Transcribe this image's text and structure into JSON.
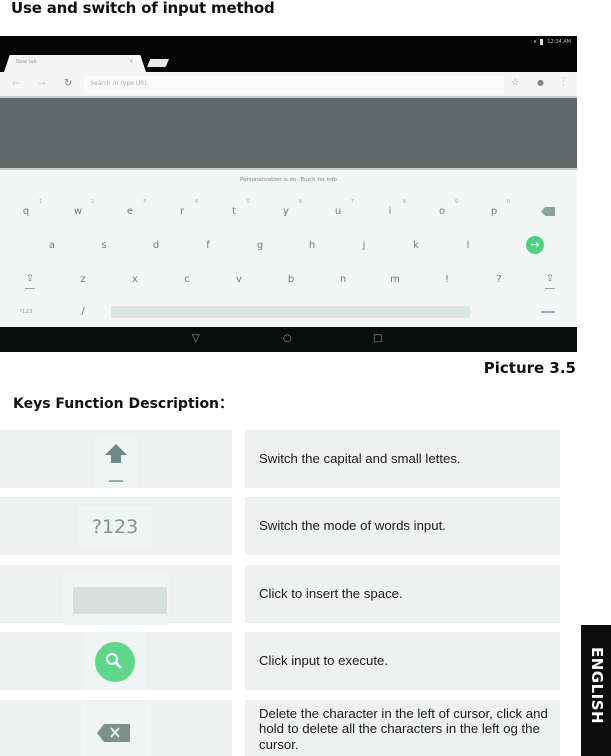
{
  "heading": "Use and switch of input method",
  "screenshot": {
    "status_bar": {
      "time": "12:34 AM"
    },
    "browser": {
      "tab_title": "New tab",
      "tab_close": "×",
      "omnibox_placeholder": "Search or type URL",
      "icons": [
        "back-icon",
        "forward-icon",
        "reload-icon",
        "star-icon",
        "mic-icon",
        "menu-icon"
      ]
    },
    "keyboard": {
      "suggestion_text": "Personalization is on. Touch for info",
      "row1": [
        {
          "key": "q",
          "hint": "1"
        },
        {
          "key": "w",
          "hint": "2"
        },
        {
          "key": "e",
          "hint": "3"
        },
        {
          "key": "r",
          "hint": "4"
        },
        {
          "key": "t",
          "hint": "5"
        },
        {
          "key": "y",
          "hint": "6"
        },
        {
          "key": "u",
          "hint": "7"
        },
        {
          "key": "i",
          "hint": "8"
        },
        {
          "key": "o",
          "hint": "9"
        },
        {
          "key": "p",
          "hint": "0"
        }
      ],
      "row2": [
        "a",
        "s",
        "d",
        "f",
        "g",
        "h",
        "j",
        "k",
        "l"
      ],
      "row3": [
        "z",
        "x",
        "c",
        "v",
        "b",
        "n",
        "m",
        "!",
        "?"
      ],
      "symbols_key": "?123",
      "slash_key": "/",
      "enter_symbol": "→",
      "shift_symbol": "⇧",
      "accent_color": "#4cd37f"
    },
    "nav_bar": {
      "back": "▽",
      "home": "○",
      "recents": "□"
    }
  },
  "caption": "Picture 3.5",
  "subheading": "Keys Function Description：",
  "keys_table": [
    {
      "icon": "shift-arrow-icon",
      "description": "Switch the capital and small lettes."
    },
    {
      "icon": "symbols-key",
      "key_label": "?123",
      "description": "Switch the mode of words input."
    },
    {
      "icon": "spacebar-icon",
      "description": "Click to insert the space."
    },
    {
      "icon": "search-execute-icon",
      "description": "Click input to execute."
    },
    {
      "icon": "backspace-icon",
      "description": "Delete the character in the left of cursor, click and hold to delete all the characters in the left og the cursor."
    }
  ],
  "side_tab": "ENGLISH"
}
